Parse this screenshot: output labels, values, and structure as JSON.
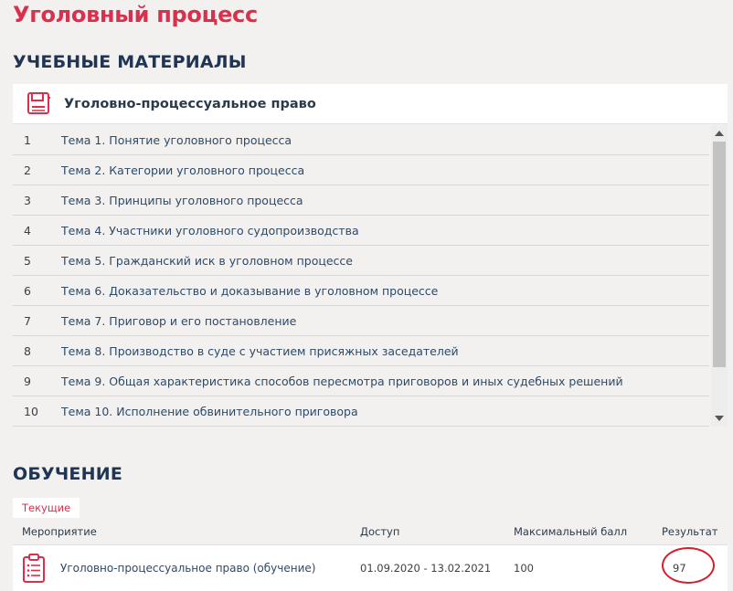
{
  "page": {
    "title": "Уголовный процесс"
  },
  "materials": {
    "title": "УЧЕБНЫЕ МАТЕРИАЛЫ",
    "course_name": "Уголовно-процессуальное право",
    "icon": "book-icon",
    "topics": [
      {
        "num": "1",
        "title": "Тема 1. Понятие уголовного процесса"
      },
      {
        "num": "2",
        "title": "Тема 2. Категории уголовного процесса"
      },
      {
        "num": "3",
        "title": "Тема 3. Принципы уголовного процесса"
      },
      {
        "num": "4",
        "title": "Тема 4. Участники уголовного судопроизводства"
      },
      {
        "num": "5",
        "title": "Тема 5. Гражданский иск в уголовном процессе"
      },
      {
        "num": "6",
        "title": "Тема 6. Доказательство и доказывание в уголовном процессе"
      },
      {
        "num": "7",
        "title": "Тема 7. Приговор и его постановление"
      },
      {
        "num": "8",
        "title": "Тема 8. Производство в суде с участием присяжных заседателей"
      },
      {
        "num": "9",
        "title": "Тема 9. Общая характеристика способов пересмотра приговоров и иных судебных решений"
      },
      {
        "num": "10",
        "title": "Тема 10. Исполнение обвинительного приговора"
      }
    ]
  },
  "training": {
    "title": "ОБУЧЕНИЕ",
    "tab_current": "Текущие",
    "columns": {
      "event": "Мероприятие",
      "access": "Доступ",
      "max_score": "Максимальный балл",
      "result": "Результат"
    },
    "rows": [
      {
        "event": "Уголовно-процессуальное право (обучение)",
        "access": "01.09.2020 - 13.02.2021",
        "max_score": "100",
        "result": "97",
        "icon": "clipboard-icon"
      }
    ]
  },
  "colors": {
    "accent": "#d9304e",
    "heading": "#1f3553",
    "link": "#2e4a67",
    "annotation_circle": "#d51f2b"
  }
}
